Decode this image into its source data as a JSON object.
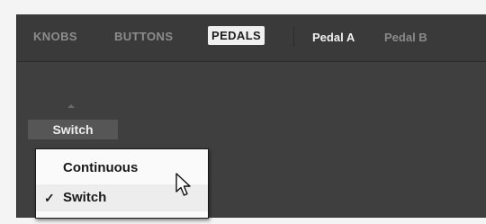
{
  "tabs": [
    {
      "label": "KNOBS",
      "active": false
    },
    {
      "label": "BUTTONS",
      "active": false
    },
    {
      "label": "PEDALS",
      "active": true
    }
  ],
  "subtabs": [
    {
      "label": "Pedal A",
      "active": true
    },
    {
      "label": "Pedal B",
      "active": false
    }
  ],
  "control": {
    "mode_label": "Switch"
  },
  "dropdown": {
    "options": [
      {
        "label": "Continuous",
        "checked": false,
        "hovered": true
      },
      {
        "label": "Switch",
        "checked": true,
        "hovered": false
      }
    ],
    "check_glyph": "✓"
  },
  "icons": {
    "pointer": "mouse-pointer-icon",
    "arrow": "up-arrow-icon",
    "check": "checkmark-icon"
  }
}
